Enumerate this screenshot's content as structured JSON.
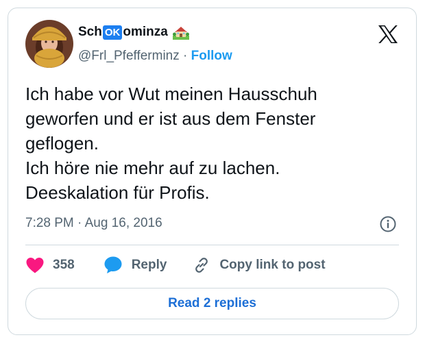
{
  "author": {
    "name_prefix": "Sch",
    "name_badge": "OK",
    "name_suffix": "ominza",
    "handle": "@Frl_Pfefferminz",
    "separator": "·",
    "follow_label": "Follow"
  },
  "tweet": {
    "lines": [
      "Ich habe vor Wut meinen Hausschuh",
      "geworfen und er ist aus dem Fenster",
      "geflogen.",
      "Ich höre nie mehr auf zu lachen.",
      "Deeskalation für Profis."
    ],
    "timestamp": "7:28 PM · Aug 16, 2016"
  },
  "actions": {
    "like_count": "358",
    "reply_label": "Reply",
    "copy_label": "Copy link to post"
  },
  "read_replies_label": "Read 2 replies",
  "icons": {
    "logo": "x-logo-icon",
    "house": "house-with-garden-icon",
    "info": "info-circle-icon",
    "like": "heart-icon",
    "reply": "speech-bubble-icon",
    "copy": "link-icon"
  },
  "colors": {
    "accent": "#1d9bf0",
    "like": "#f91880",
    "reply": "#1d9bf0",
    "badge": "#1d7ff0",
    "muted": "#536471",
    "border": "#cfd9de"
  }
}
